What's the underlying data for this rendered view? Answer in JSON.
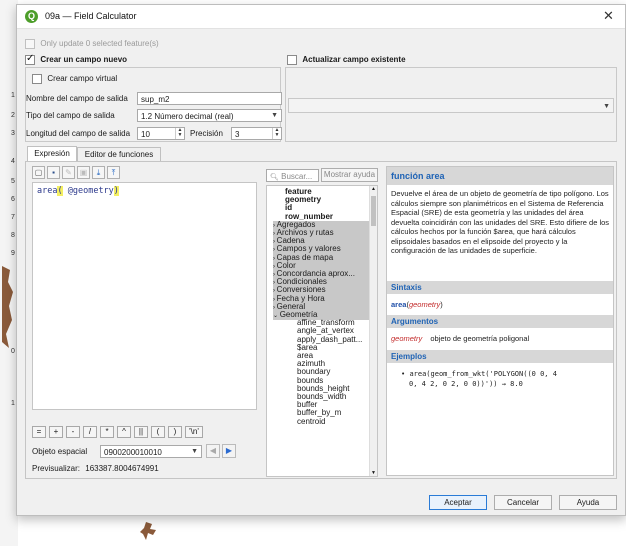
{
  "window": {
    "title": "09a — Field Calculator",
    "close_glyph": "✕",
    "icon": "qgis-icon"
  },
  "options": {
    "only_update": "Only update 0 selected feature(s)",
    "create_new": "Crear un campo nuevo",
    "update_existing": "Actualizar campo existente",
    "virtual": "Crear campo virtual",
    "out_name_label": "Nombre del campo de salida",
    "out_name_value": "sup_m2",
    "out_type_label": "Tipo del campo de salida",
    "out_type_value": "1.2 Número decimal (real)",
    "out_len_label": "Longitud del campo de salida",
    "out_len_value": "10",
    "precision_label": "Precisión",
    "precision_value": "3"
  },
  "tabs": [
    "Expresión",
    "Editor de funciones"
  ],
  "expression": {
    "fn": "area",
    "open": "(",
    "arg": "@geometry",
    "close": ")"
  },
  "operators": [
    "=",
    "+",
    "-",
    "/",
    "*",
    "^",
    "||",
    "(",
    ")",
    "'\\n'"
  ],
  "feature": {
    "label": "Objeto espacial",
    "value": "0900200010010"
  },
  "preview": {
    "label": "Previsualizar:",
    "value": "163387.8004674991"
  },
  "search": {
    "placeholder": "Buscar...",
    "show_help": "Mostrar ayuda"
  },
  "tree": {
    "bold_items": [
      "feature",
      "geometry",
      "id",
      "row_number"
    ],
    "groups": [
      "Agregados",
      "Archivos y rutas",
      "Cadena",
      "Campos y valores",
      "Capas de mapa",
      "Color",
      "Concordancia aprox...",
      "Condicionales",
      "Conversiones",
      "Fecha y Hora",
      "General",
      "Geometría"
    ],
    "children": [
      "affine_transform",
      "angle_at_vertex",
      "apply_dash_patt...",
      "$area",
      "area",
      "azimuth",
      "boundary",
      "bounds",
      "bounds_height",
      "bounds_width",
      "buffer",
      "buffer_by_m",
      "centroid"
    ]
  },
  "help": {
    "title": "función area",
    "description": "Devuelve el área de un objeto de geometría de tipo polígono. Los cálculos siempre son planimétricos en el Sistema de Referencia Espacial (SRE) de esta geometría y las unidades del área devuelta coincidirán con las unidades del SRE. Esto difiere de los cálculos hechos por la función $area, que hará cálculos elipsoidales basados en el elipsoide del proyecto y la configuración de las unidades de superficie.",
    "syntax_header": "Sintaxis",
    "syntax_fn": "area",
    "syntax_arg": "geometry",
    "args_header": "Argumentos",
    "arg_name": "geometry",
    "arg_desc": "objeto de geometría poligonal",
    "examples_header": "Ejemplos",
    "example_line1": "area(geom_from_wkt('POLYGON((0 0, 4",
    "example_line2": "0, 4 2, 0 2, 0 0))')) → 8.0"
  },
  "buttons": {
    "accept": "Aceptar",
    "cancel": "Cancelar",
    "help": "Ayuda"
  },
  "background": {
    "row_numbers": [
      "1",
      "2",
      "3",
      "4",
      "5",
      "6",
      "7",
      "8",
      "9",
      "0",
      "1"
    ]
  }
}
